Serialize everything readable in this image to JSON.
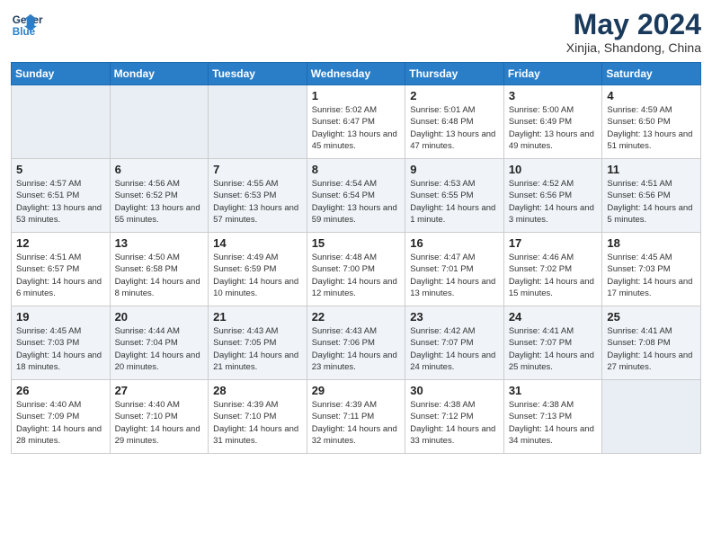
{
  "header": {
    "logo_line1": "General",
    "logo_line2": "Blue",
    "month_title": "May 2024",
    "location": "Xinjia, Shandong, China"
  },
  "days_of_week": [
    "Sunday",
    "Monday",
    "Tuesday",
    "Wednesday",
    "Thursday",
    "Friday",
    "Saturday"
  ],
  "weeks": [
    [
      {
        "day": "",
        "info": ""
      },
      {
        "day": "",
        "info": ""
      },
      {
        "day": "",
        "info": ""
      },
      {
        "day": "1",
        "info": "Sunrise: 5:02 AM\nSunset: 6:47 PM\nDaylight: 13 hours\nand 45 minutes."
      },
      {
        "day": "2",
        "info": "Sunrise: 5:01 AM\nSunset: 6:48 PM\nDaylight: 13 hours\nand 47 minutes."
      },
      {
        "day": "3",
        "info": "Sunrise: 5:00 AM\nSunset: 6:49 PM\nDaylight: 13 hours\nand 49 minutes."
      },
      {
        "day": "4",
        "info": "Sunrise: 4:59 AM\nSunset: 6:50 PM\nDaylight: 13 hours\nand 51 minutes."
      }
    ],
    [
      {
        "day": "5",
        "info": "Sunrise: 4:57 AM\nSunset: 6:51 PM\nDaylight: 13 hours\nand 53 minutes."
      },
      {
        "day": "6",
        "info": "Sunrise: 4:56 AM\nSunset: 6:52 PM\nDaylight: 13 hours\nand 55 minutes."
      },
      {
        "day": "7",
        "info": "Sunrise: 4:55 AM\nSunset: 6:53 PM\nDaylight: 13 hours\nand 57 minutes."
      },
      {
        "day": "8",
        "info": "Sunrise: 4:54 AM\nSunset: 6:54 PM\nDaylight: 13 hours\nand 59 minutes."
      },
      {
        "day": "9",
        "info": "Sunrise: 4:53 AM\nSunset: 6:55 PM\nDaylight: 14 hours\nand 1 minute."
      },
      {
        "day": "10",
        "info": "Sunrise: 4:52 AM\nSunset: 6:56 PM\nDaylight: 14 hours\nand 3 minutes."
      },
      {
        "day": "11",
        "info": "Sunrise: 4:51 AM\nSunset: 6:56 PM\nDaylight: 14 hours\nand 5 minutes."
      }
    ],
    [
      {
        "day": "12",
        "info": "Sunrise: 4:51 AM\nSunset: 6:57 PM\nDaylight: 14 hours\nand 6 minutes."
      },
      {
        "day": "13",
        "info": "Sunrise: 4:50 AM\nSunset: 6:58 PM\nDaylight: 14 hours\nand 8 minutes."
      },
      {
        "day": "14",
        "info": "Sunrise: 4:49 AM\nSunset: 6:59 PM\nDaylight: 14 hours\nand 10 minutes."
      },
      {
        "day": "15",
        "info": "Sunrise: 4:48 AM\nSunset: 7:00 PM\nDaylight: 14 hours\nand 12 minutes."
      },
      {
        "day": "16",
        "info": "Sunrise: 4:47 AM\nSunset: 7:01 PM\nDaylight: 14 hours\nand 13 minutes."
      },
      {
        "day": "17",
        "info": "Sunrise: 4:46 AM\nSunset: 7:02 PM\nDaylight: 14 hours\nand 15 minutes."
      },
      {
        "day": "18",
        "info": "Sunrise: 4:45 AM\nSunset: 7:03 PM\nDaylight: 14 hours\nand 17 minutes."
      }
    ],
    [
      {
        "day": "19",
        "info": "Sunrise: 4:45 AM\nSunset: 7:03 PM\nDaylight: 14 hours\nand 18 minutes."
      },
      {
        "day": "20",
        "info": "Sunrise: 4:44 AM\nSunset: 7:04 PM\nDaylight: 14 hours\nand 20 minutes."
      },
      {
        "day": "21",
        "info": "Sunrise: 4:43 AM\nSunset: 7:05 PM\nDaylight: 14 hours\nand 21 minutes."
      },
      {
        "day": "22",
        "info": "Sunrise: 4:43 AM\nSunset: 7:06 PM\nDaylight: 14 hours\nand 23 minutes."
      },
      {
        "day": "23",
        "info": "Sunrise: 4:42 AM\nSunset: 7:07 PM\nDaylight: 14 hours\nand 24 minutes."
      },
      {
        "day": "24",
        "info": "Sunrise: 4:41 AM\nSunset: 7:07 PM\nDaylight: 14 hours\nand 25 minutes."
      },
      {
        "day": "25",
        "info": "Sunrise: 4:41 AM\nSunset: 7:08 PM\nDaylight: 14 hours\nand 27 minutes."
      }
    ],
    [
      {
        "day": "26",
        "info": "Sunrise: 4:40 AM\nSunset: 7:09 PM\nDaylight: 14 hours\nand 28 minutes."
      },
      {
        "day": "27",
        "info": "Sunrise: 4:40 AM\nSunset: 7:10 PM\nDaylight: 14 hours\nand 29 minutes."
      },
      {
        "day": "28",
        "info": "Sunrise: 4:39 AM\nSunset: 7:10 PM\nDaylight: 14 hours\nand 31 minutes."
      },
      {
        "day": "29",
        "info": "Sunrise: 4:39 AM\nSunset: 7:11 PM\nDaylight: 14 hours\nand 32 minutes."
      },
      {
        "day": "30",
        "info": "Sunrise: 4:38 AM\nSunset: 7:12 PM\nDaylight: 14 hours\nand 33 minutes."
      },
      {
        "day": "31",
        "info": "Sunrise: 4:38 AM\nSunset: 7:13 PM\nDaylight: 14 hours\nand 34 minutes."
      },
      {
        "day": "",
        "info": ""
      }
    ]
  ]
}
